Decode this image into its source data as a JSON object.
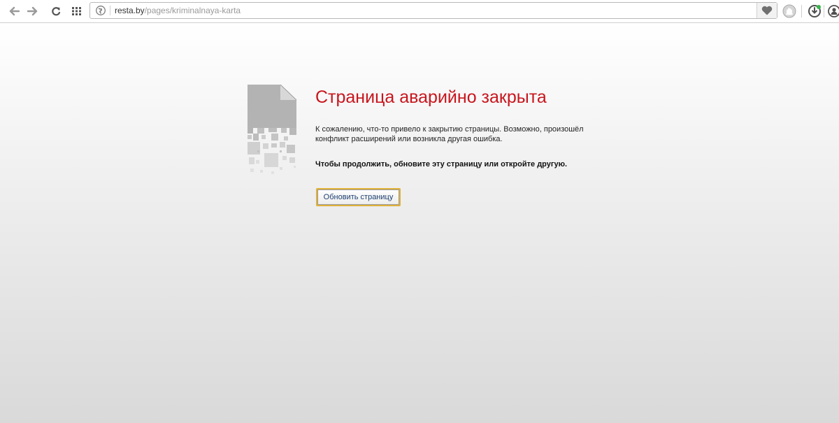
{
  "browser": {
    "url_host": "resta.by",
    "url_path": "/pages/kriminalnaya-karta",
    "icons": {
      "back": "arrow-left-icon",
      "forward": "arrow-right-icon",
      "reload": "reload-icon",
      "speed_dial": "grid-icon",
      "site_info": "globe-icon",
      "favorite": "heart-icon",
      "extension_1": "hand-icon",
      "extension_2": "download-icon",
      "account": "user-icon"
    }
  },
  "error_page": {
    "title": "Страница аварийно закрыта",
    "description": "К сожалению, что-то привело к закрытию страницы. Возможно, произошёл конфликт расширений или возникла другая ошибка.",
    "instruction": "Чтобы продолжить, обновите эту страницу или откройте другую.",
    "reload_button_label": "Обновить страницу",
    "colors": {
      "title": "#c8161d",
      "button_border": "#e1b23a"
    }
  }
}
